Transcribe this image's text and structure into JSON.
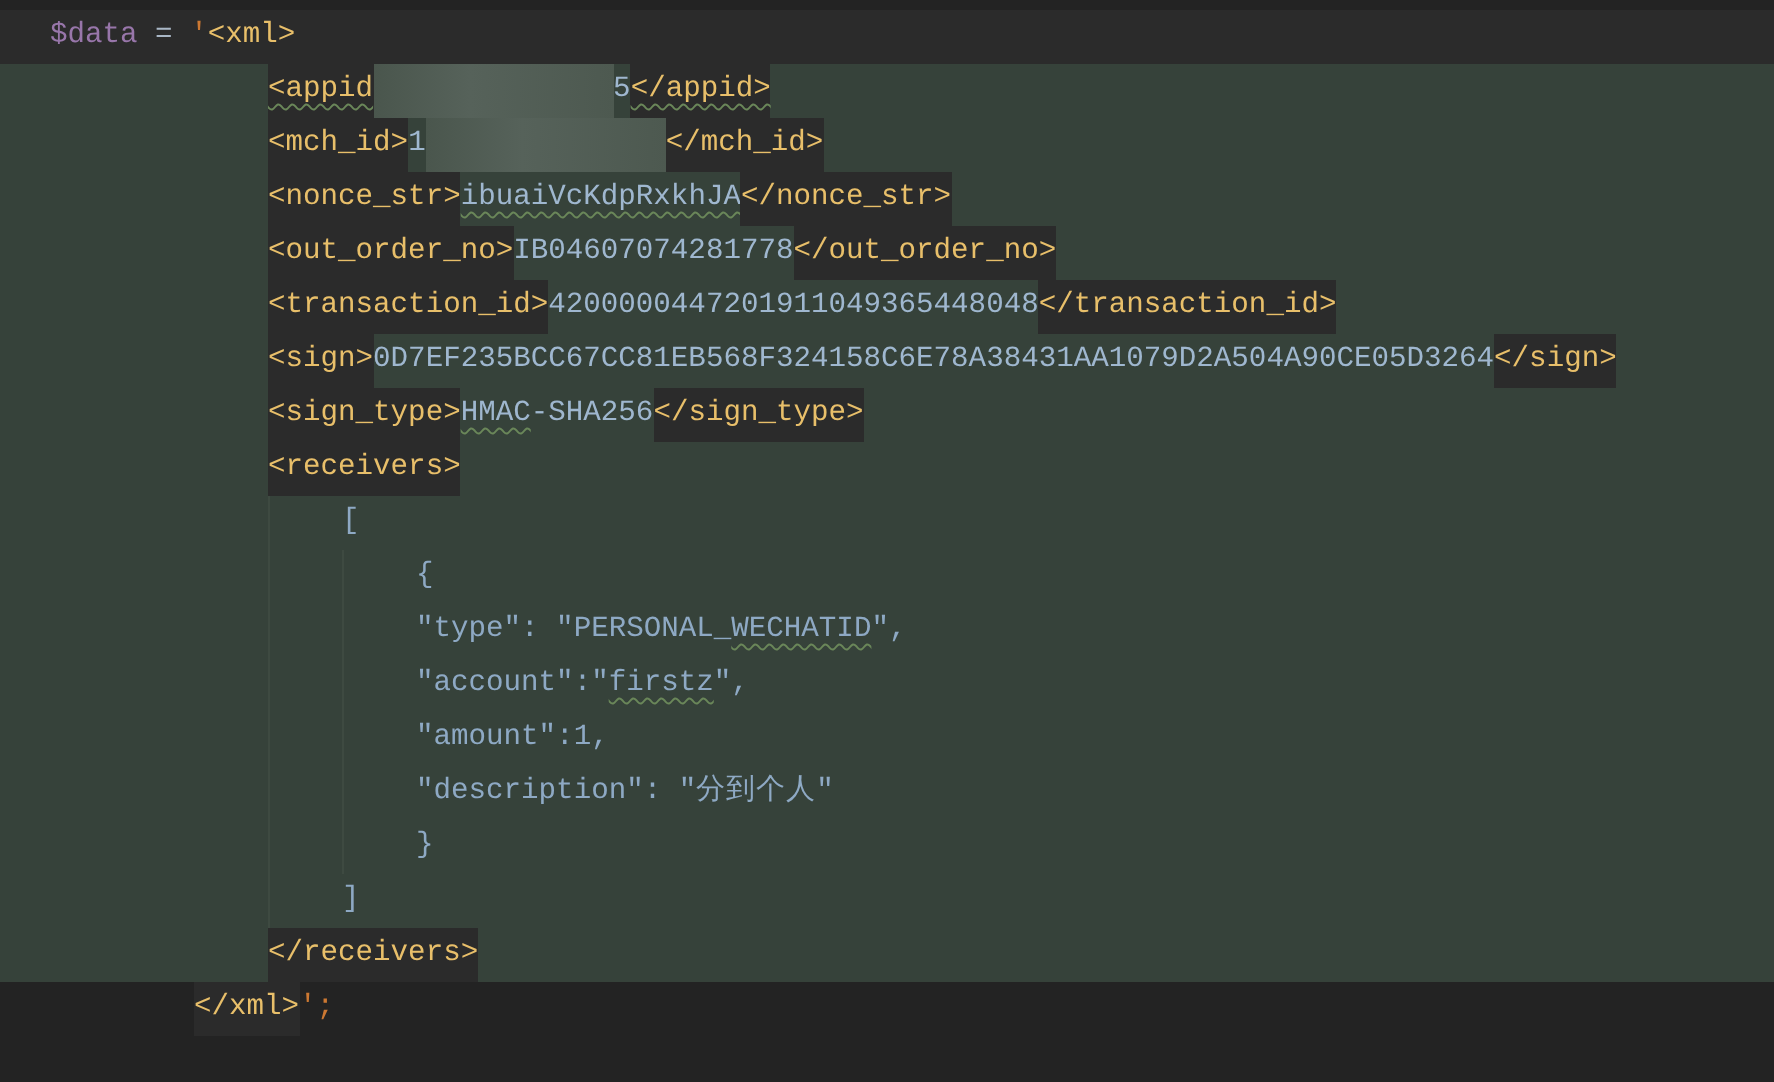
{
  "editor": {
    "lines": [
      {
        "segments": [
          {
            "kind": "variable",
            "text": "$data"
          },
          {
            "kind": "operator",
            "text": " = "
          },
          {
            "kind": "quote",
            "text": "'"
          },
          {
            "kind": "tag",
            "text": "<xml>"
          }
        ],
        "children": [
          {
            "segments": [
              {
                "kind": "tag",
                "text": "<appid",
                "typo": true
              },
              {
                "kind": "redacted"
              },
              {
                "kind": "value",
                "text": "5"
              },
              {
                "kind": "tag",
                "text": "</appid>",
                "typo": true
              }
            ]
          },
          {
            "segments": [
              {
                "kind": "tag",
                "text": "<mch_id>"
              },
              {
                "kind": "value",
                "text": "1"
              },
              {
                "kind": "redacted"
              },
              {
                "kind": "tag",
                "text": "</mch_id>"
              }
            ]
          },
          {
            "segments": [
              {
                "kind": "tag",
                "text": "<nonce_str>"
              },
              {
                "kind": "value",
                "text": "ibuaiVcKdpRxkhJA",
                "typo": true
              },
              {
                "kind": "tag",
                "text": "</nonce_str>"
              }
            ]
          },
          {
            "segments": [
              {
                "kind": "tag",
                "text": "<out_order_no>"
              },
              {
                "kind": "value",
                "text": "IB04607074281778"
              },
              {
                "kind": "tag",
                "text": "</out_order_no>"
              }
            ]
          },
          {
            "segments": [
              {
                "kind": "tag",
                "text": "<transaction_id>"
              },
              {
                "kind": "value",
                "text": "4200000447201911049365448048"
              },
              {
                "kind": "tag",
                "text": "</transaction_id>"
              }
            ]
          },
          {
            "segments": [
              {
                "kind": "tag",
                "text": "<sign>"
              },
              {
                "kind": "value",
                "text": "0D7EF235BCC67CC81EB568F324158C6E78A38431AA1079D2A504A90CE05D3264"
              },
              {
                "kind": "tag",
                "text": "</sign>"
              }
            ]
          },
          {
            "segments": [
              {
                "kind": "tag",
                "text": "<sign_type>"
              },
              {
                "kind": "value",
                "text": "HMAC",
                "typo": true
              },
              {
                "kind": "value",
                "text": "-SHA256"
              },
              {
                "kind": "tag",
                "text": "</sign_type>"
              }
            ]
          },
          {
            "segments": [
              {
                "kind": "tag",
                "text": "<receivers>"
              }
            ],
            "children": [
              {
                "segments": [
                  {
                    "kind": "json",
                    "text": "["
                  }
                ],
                "children": [
                  {
                    "segments": [
                      {
                        "kind": "json",
                        "text": "{"
                      }
                    ]
                  },
                  {
                    "segments": [
                      {
                        "kind": "json",
                        "text": "\"type\": \"PERSONAL_"
                      },
                      {
                        "kind": "json",
                        "text": "WECHATID",
                        "typo": true
                      },
                      {
                        "kind": "json",
                        "text": "\","
                      }
                    ]
                  },
                  {
                    "segments": [
                      {
                        "kind": "json",
                        "text": "\"account\":\""
                      },
                      {
                        "kind": "json",
                        "text": "firstz",
                        "typo": true
                      },
                      {
                        "kind": "json",
                        "text": "\","
                      }
                    ]
                  },
                  {
                    "segments": [
                      {
                        "kind": "json",
                        "text": "\"amount\":1,"
                      }
                    ]
                  },
                  {
                    "segments": [
                      {
                        "kind": "json",
                        "text": "\"description\": \"分到个人\""
                      }
                    ]
                  },
                  {
                    "segments": [
                      {
                        "kind": "json",
                        "text": "}"
                      }
                    ]
                  }
                ]
              },
              {
                "segments": [
                  {
                    "kind": "json",
                    "text": "]"
                  }
                ]
              }
            ]
          },
          {
            "segments": [
              {
                "kind": "tag",
                "text": "</receivers>"
              }
            ]
          }
        ]
      },
      {
        "segments": [
          {
            "kind": "tag",
            "text": "</xml>"
          },
          {
            "kind": "quote",
            "text": "';"
          }
        ]
      }
    ]
  }
}
